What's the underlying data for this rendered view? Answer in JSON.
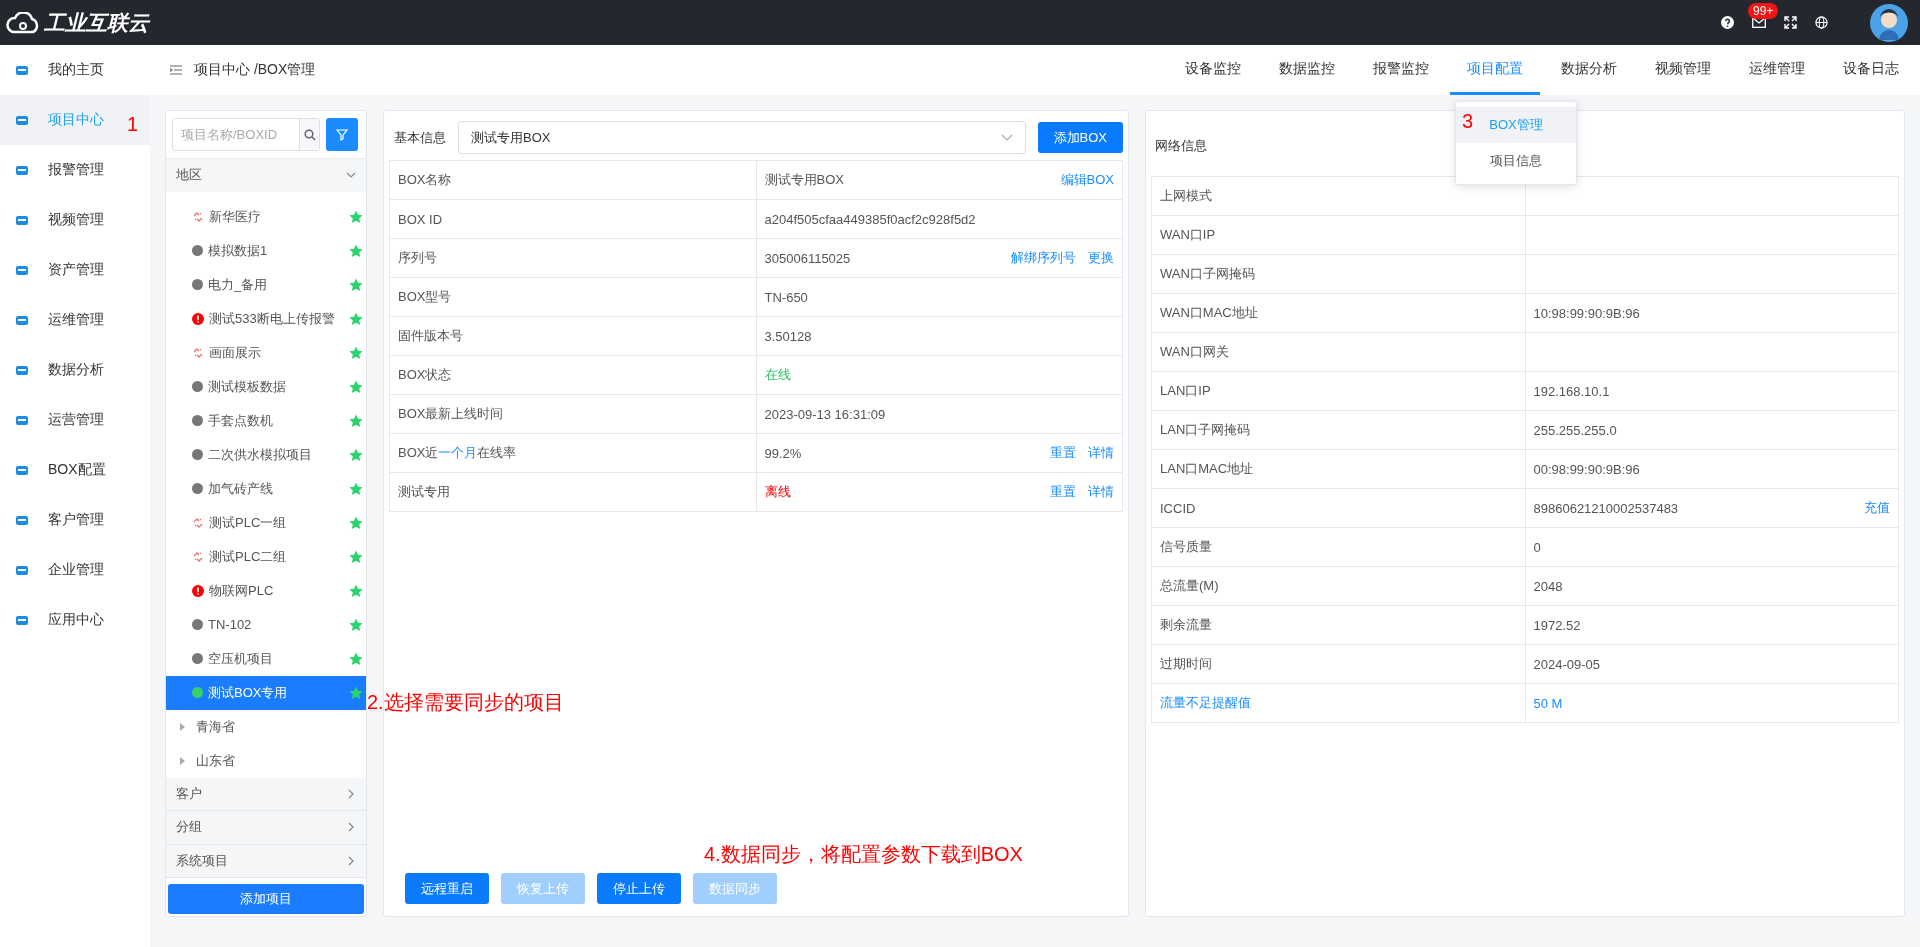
{
  "header": {
    "logo": "工业互联云",
    "badge": "99+"
  },
  "sidebar": {
    "items": [
      {
        "label": "我的主页",
        "selected": false
      },
      {
        "label": "项目中心",
        "selected": true
      },
      {
        "label": "报警管理",
        "selected": false
      },
      {
        "label": "视频管理",
        "selected": false
      },
      {
        "label": "资产管理",
        "selected": false
      },
      {
        "label": "运维管理",
        "selected": false
      },
      {
        "label": "数据分析",
        "selected": false
      },
      {
        "label": "运营管理",
        "selected": false
      },
      {
        "label": "BOX配置",
        "selected": false
      },
      {
        "label": "客户管理",
        "selected": false
      },
      {
        "label": "企业管理",
        "selected": false
      },
      {
        "label": "应用中心",
        "selected": false
      }
    ]
  },
  "breadcrumb": "项目中心 /BOX管理",
  "tabs": [
    {
      "label": "设备监控",
      "selected": false
    },
    {
      "label": "数据监控",
      "selected": false
    },
    {
      "label": "报警监控",
      "selected": false
    },
    {
      "label": "项目配置",
      "selected": true
    },
    {
      "label": "数据分析",
      "selected": false
    },
    {
      "label": "视频管理",
      "selected": false
    },
    {
      "label": "运维管理",
      "selected": false
    },
    {
      "label": "设备日志",
      "selected": false
    }
  ],
  "dropdown_menu": [
    {
      "label": "BOX管理",
      "selected": true
    },
    {
      "label": "项目信息",
      "selected": false
    }
  ],
  "project_tree": {
    "search": {
      "placeholder": "项目名称/BOXID"
    },
    "region": {
      "label": "地区",
      "expanded": true,
      "children": [
        {
          "label": "新华医疗",
          "kind": "unlinked",
          "selected": false
        },
        {
          "label": "模拟数据1",
          "kind": "offline",
          "selected": false
        },
        {
          "label": "电力_备用",
          "kind": "offline",
          "selected": false
        },
        {
          "label": "测试533断电上传报警",
          "kind": "alarm",
          "selected": false
        },
        {
          "label": "画面展示",
          "kind": "unlinked",
          "selected": false
        },
        {
          "label": "测试模板数据",
          "kind": "offline",
          "selected": false
        },
        {
          "label": "手套点数机",
          "kind": "offline",
          "selected": false
        },
        {
          "label": "二次供水模拟项目",
          "kind": "offline",
          "selected": false
        },
        {
          "label": "加气砖产线",
          "kind": "offline",
          "selected": false
        },
        {
          "label": "测试PLC一组",
          "kind": "unlinked",
          "selected": false
        },
        {
          "label": "测试PLC二组",
          "kind": "unlinked",
          "selected": false
        },
        {
          "label": "物联网PLC",
          "kind": "alarm",
          "selected": false
        },
        {
          "label": "TN-102",
          "kind": "offline",
          "selected": false
        },
        {
          "label": "空压机项目",
          "kind": "offline",
          "selected": false
        },
        {
          "label": "测试BOX专用",
          "kind": "online",
          "selected": true
        }
      ],
      "provinces": [
        {
          "label": "青海省",
          "expanded": false
        },
        {
          "label": "山东省",
          "expanded": false
        }
      ]
    },
    "groups": [
      {
        "label": "客户",
        "expanded": false
      },
      {
        "label": "分组",
        "expanded": false
      },
      {
        "label": "系统项目",
        "expanded": false
      }
    ],
    "add_button": "添加项目"
  },
  "basic_info": {
    "label": "基本信息",
    "box_select": "测试专用BOX",
    "add_button": "添加BOX",
    "rows": [
      {
        "name": "BOX名称",
        "value": "测试专用BOX",
        "actions": [
          "编辑BOX"
        ]
      },
      {
        "name": "BOX ID",
        "value": "a204f505cfaa449385f0acf2c928f5d2",
        "actions": []
      },
      {
        "name": "序列号",
        "value": "305006115025",
        "actions": [
          "解绑序列号",
          "更换"
        ]
      },
      {
        "name": "BOX型号",
        "value": "TN-650",
        "actions": []
      },
      {
        "name": "固件版本号",
        "value": "3.50128",
        "actions": []
      },
      {
        "name": "BOX状态",
        "value": "在线",
        "color": "#2dc060",
        "actions": []
      },
      {
        "name": "BOX最新上线时间",
        "value": "2023-09-13 16:31:09",
        "actions": []
      },
      {
        "name": "BOX近**一个月**在线率",
        "value": "99.2%",
        "actions": [
          "重置",
          "详情"
        ]
      },
      {
        "name": "测试专用",
        "value": "离线",
        "color": "#ff0000",
        "actions": [
          "重置",
          "详情"
        ]
      }
    ],
    "buttons": [
      {
        "label": "远程重启",
        "disabled": false
      },
      {
        "label": "恢复上传",
        "disabled": true
      },
      {
        "label": "停止上传",
        "disabled": false
      },
      {
        "label": "数据同步",
        "disabled": true
      }
    ]
  },
  "network_info": {
    "label": "网络信息",
    "rows": [
      {
        "name": "上网模式"
      },
      {
        "name": "WAN口IP"
      },
      {
        "name": "WAN口子网掩码"
      },
      {
        "name": "WAN口MAC地址",
        "value": "10:98:99:90:9B:96"
      },
      {
        "name": "WAN口网关"
      },
      {
        "name": "LAN口IP",
        "value": "192.168.10.1"
      },
      {
        "name": "LAN口子网掩码",
        "value": "255.255.255.0"
      },
      {
        "name": "LAN口MAC地址",
        "value": "00:98:99:90:9B:96"
      },
      {
        "name": "ICCID",
        "value": "89860621210002537483",
        "action": "充值"
      },
      {
        "name": "信号质量",
        "value": "0"
      },
      {
        "name": "总流量(M)",
        "value": "2048"
      },
      {
        "name": "剩余流量",
        "value": "1972.52"
      },
      {
        "name": "过期时间",
        "value": "2024-09-05"
      },
      {
        "name": "流量不足提醒值",
        "value": "50  M",
        "link": true
      }
    ]
  },
  "annotations": [
    "1",
    "2.选择需要同步的项目",
    "3",
    "4.数据同步，将配置参数下载到BOX"
  ]
}
